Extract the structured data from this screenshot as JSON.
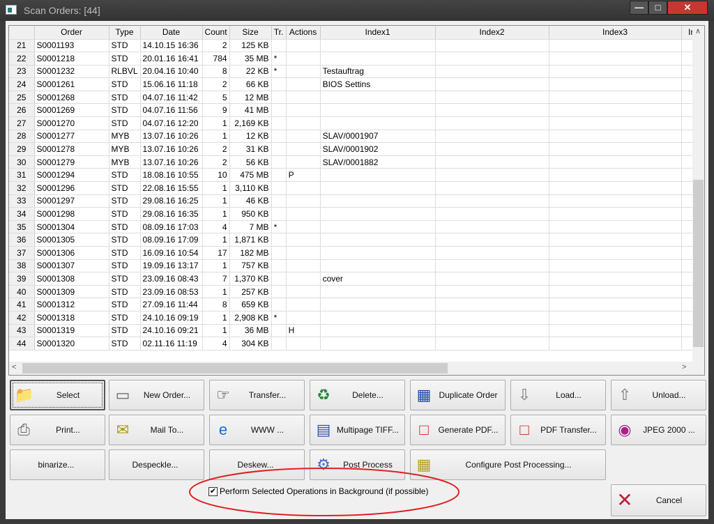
{
  "window": {
    "title": "Scan Orders: [44]"
  },
  "grid": {
    "columns": [
      "",
      "Order",
      "Type",
      "Date",
      "Count",
      "Size",
      "Tr.",
      "Actions",
      "Index1",
      "Index2",
      "Index3",
      "In"
    ],
    "rows": [
      [
        "21",
        "S0001193",
        "STD",
        "14.10.15 16:36",
        "2",
        "125 KB",
        "",
        "",
        ""
      ],
      [
        "22",
        "S0001218",
        "STD",
        "20.01.16 16:41",
        "784",
        "35 MB",
        "*",
        "",
        ""
      ],
      [
        "23",
        "S0001232",
        "RLBVL",
        "20.04.16 10:40",
        "8",
        "22 KB",
        "*",
        "",
        "Testauftrag"
      ],
      [
        "24",
        "S0001261",
        "STD",
        "15.06.16 11:18",
        "2",
        "66 KB",
        "",
        "",
        "BIOS Settins"
      ],
      [
        "25",
        "S0001268",
        "STD",
        "04.07.16 11:42",
        "5",
        "12 MB",
        "",
        "",
        ""
      ],
      [
        "26",
        "S0001269",
        "STD",
        "04.07.16 11:56",
        "9",
        "41 MB",
        "",
        "",
        ""
      ],
      [
        "27",
        "S0001270",
        "STD",
        "04.07.16 12:20",
        "1",
        "2,169 KB",
        "",
        "",
        ""
      ],
      [
        "28",
        "S0001277",
        "MYB",
        "13.07.16 10:26",
        "1",
        "12 KB",
        "",
        "",
        "SLAV/0001907"
      ],
      [
        "29",
        "S0001278",
        "MYB",
        "13.07.16 10:26",
        "2",
        "31 KB",
        "",
        "",
        "SLAV/0001902"
      ],
      [
        "30",
        "S0001279",
        "MYB",
        "13.07.16 10:26",
        "2",
        "56 KB",
        "",
        "",
        "SLAV/0001882"
      ],
      [
        "31",
        "S0001294",
        "STD",
        "18.08.16 10:55",
        "10",
        "475 MB",
        "",
        "P",
        ""
      ],
      [
        "32",
        "S0001296",
        "STD",
        "22.08.16 15:55",
        "1",
        "3,110 KB",
        "",
        "",
        ""
      ],
      [
        "33",
        "S0001297",
        "STD",
        "29.08.16 16:25",
        "1",
        "46 KB",
        "",
        "",
        ""
      ],
      [
        "34",
        "S0001298",
        "STD",
        "29.08.16 16:35",
        "1",
        "950 KB",
        "",
        "",
        ""
      ],
      [
        "35",
        "S0001304",
        "STD",
        "08.09.16 17:03",
        "4",
        "7 MB",
        "*",
        "",
        ""
      ],
      [
        "36",
        "S0001305",
        "STD",
        "08.09.16 17:09",
        "1",
        "1,871 KB",
        "",
        "",
        ""
      ],
      [
        "37",
        "S0001306",
        "STD",
        "16.09.16 10:54",
        "17",
        "182 MB",
        "",
        "",
        ""
      ],
      [
        "38",
        "S0001307",
        "STD",
        "19.09.16 13:17",
        "1",
        "757 KB",
        "",
        "",
        ""
      ],
      [
        "39",
        "S0001308",
        "STD",
        "23.09.16 08:43",
        "7",
        "1,370 KB",
        "",
        "",
        "cover"
      ],
      [
        "40",
        "S0001309",
        "STD",
        "23.09.16 08:53",
        "1",
        "257 KB",
        "",
        "",
        ""
      ],
      [
        "41",
        "S0001312",
        "STD",
        "27.09.16 11:44",
        "8",
        "659 KB",
        "",
        "",
        ""
      ],
      [
        "42",
        "S0001318",
        "STD",
        "24.10.16 09:19",
        "1",
        "2,908 KB",
        "*",
        "",
        ""
      ],
      [
        "43",
        "S0001319",
        "STD",
        "24.10.16 09:21",
        "1",
        "36 MB",
        "",
        "H",
        ""
      ],
      [
        "44",
        "S0001320",
        "STD",
        "02.11.16 11:19",
        "4",
        "304 KB",
        "",
        "",
        ""
      ]
    ]
  },
  "buttons": [
    {
      "label": "Select",
      "icon": "folder-icon"
    },
    {
      "label": "New Order...",
      "icon": "document-icon"
    },
    {
      "label": "Transfer...",
      "icon": "hand-point-icon"
    },
    {
      "label": "Delete...",
      "icon": "recycle-bin-icon"
    },
    {
      "label": "Duplicate Order",
      "icon": "calendar-grid-icon"
    },
    {
      "label": "Load...",
      "icon": "arrow-down-icon"
    },
    {
      "label": "Unload...",
      "icon": "arrow-up-icon"
    },
    {
      "label": "Print...",
      "icon": "printer-icon"
    },
    {
      "label": "Mail To...",
      "icon": "mail-icon"
    },
    {
      "label": "WWW ...",
      "icon": "internet-explorer-icon"
    },
    {
      "label": "Multipage TIFF...",
      "icon": "multipage-icon"
    },
    {
      "label": "Generate PDF...",
      "icon": "pdf-icon"
    },
    {
      "label": "PDF Transfer...",
      "icon": "pdf-icon"
    },
    {
      "label": "JPEG 2000 ...",
      "icon": "color-circles-icon"
    },
    {
      "label": "binarize...",
      "icon": ""
    },
    {
      "label": "Despeckle...",
      "icon": ""
    },
    {
      "label": "Deskew...",
      "icon": ""
    },
    {
      "label": "Post Process",
      "icon": "gear-icon"
    },
    {
      "label": "Configure Post Processing...",
      "icon": "folder-tools-icon"
    }
  ],
  "background_checkbox": {
    "label": "Perform Selected Operations in Background (if possible)",
    "checked": true
  },
  "cancel": {
    "label": "Cancel",
    "icon": "x-icon"
  },
  "colors": {
    "annotation": "#e02020",
    "cancel_x": "#c0203a"
  }
}
